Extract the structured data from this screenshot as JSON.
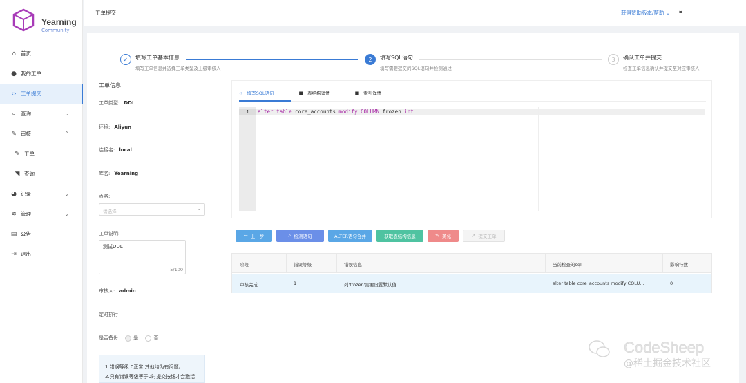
{
  "brand": {
    "name": "Yearning",
    "edition": "Community"
  },
  "menu": [
    {
      "label": "首页",
      "icon": "home-icon",
      "glyph": "⌂",
      "chevron": ""
    },
    {
      "label": "我的工单",
      "icon": "user-icon",
      "glyph": "●",
      "chevron": ""
    },
    {
      "label": "工单提交",
      "icon": "code-icon",
      "glyph": "‹›",
      "chevron": ""
    },
    {
      "label": "查询",
      "icon": "search-icon",
      "glyph": "⌕",
      "chevron": "⌄"
    },
    {
      "label": "审核",
      "icon": "edit-icon",
      "glyph": "✎",
      "chevron": "⌃"
    },
    {
      "label": "工单",
      "icon": "pen-icon",
      "glyph": "✎",
      "chevron": ""
    },
    {
      "label": "查询",
      "icon": "rss-icon",
      "glyph": "◥",
      "chevron": ""
    },
    {
      "label": "记录",
      "icon": "pie-chart-icon",
      "glyph": "◕",
      "chevron": "⌄"
    },
    {
      "label": "管理",
      "icon": "layers-icon",
      "glyph": "≋",
      "chevron": "⌄"
    },
    {
      "label": "公告",
      "icon": "clipboard-icon",
      "glyph": "▤",
      "chevron": ""
    },
    {
      "label": "退出",
      "icon": "logout-icon",
      "glyph": "⇥",
      "chevron": ""
    }
  ],
  "topbar": {
    "title": "工单提交",
    "help": "获得赞助版本/帮助 ⌄"
  },
  "steps": [
    {
      "title": "填写工单基本信息",
      "desc": "填写工单信息并选择工单类型及上级审核人",
      "marker": "✓",
      "state": "done"
    },
    {
      "title": "填写SQL语句",
      "desc": "填写需要提交的SQL语句并检测通过",
      "marker": "2",
      "state": "current"
    },
    {
      "title": "确认工单并提交",
      "desc": "检查工单信息确认并提交至对应审核人",
      "marker": "3",
      "state": "wait"
    }
  ],
  "form": {
    "section_title": "工单信息",
    "type_label": "工单类型:",
    "type_value": "DDL",
    "env_label": "环境:",
    "env_value": "Aliyun",
    "conn_label": "连接名:",
    "conn_value": "local",
    "db_label": "库名:",
    "db_value": "Yearning",
    "table_label": "表名:",
    "table_placeholder": "请选择",
    "desc_label": "工单说明:",
    "desc_value": "测试DDL",
    "desc_count": "5/100",
    "reviewer_label": "审核人:",
    "reviewer_value": "admin",
    "schedule_label": "定时执行",
    "backup_label": "是否备份",
    "backup_yes": "是",
    "backup_no": "否"
  },
  "tips": [
    "1.错误等级 0正常,其他均为有问题。",
    "2.只有错误等级等于0时提交按钮才会激活"
  ],
  "editor": {
    "tabs": [
      {
        "label": "填写SQL语句",
        "icon": "code-icon",
        "glyph": "‹›"
      },
      {
        "label": "表结构详情",
        "icon": "folder-icon",
        "glyph": "■"
      },
      {
        "label": "索引详情",
        "icon": "folder-icon",
        "glyph": "■"
      }
    ],
    "line_number": "1"
  },
  "sql_tokens": [
    {
      "t": "alter",
      "kw": true
    },
    {
      "t": " ",
      "kw": false
    },
    {
      "t": "table",
      "kw": true
    },
    {
      "t": " core_accounts ",
      "kw": false
    },
    {
      "t": "modify",
      "kw": true
    },
    {
      "t": " ",
      "kw": false
    },
    {
      "t": "COLUMN",
      "kw": true
    },
    {
      "t": " frozen ",
      "kw": false
    },
    {
      "t": "int",
      "kw": true
    }
  ],
  "buttons": [
    {
      "label": "上一步",
      "icon": "arrow-left-icon",
      "glyph": "←",
      "color": "#5aa7e6",
      "name": "prev-step-button"
    },
    {
      "label": "检测语句",
      "icon": "search-icon",
      "glyph": "⌕",
      "color": "#6b8fe8",
      "name": "check-sql-button"
    },
    {
      "label": "ALTER语句合并",
      "icon": "",
      "glyph": "",
      "color": "#5aa7e6",
      "name": "merge-alter-button"
    },
    {
      "label": "获取表结构信息",
      "icon": "",
      "glyph": "",
      "color": "#4fc3a1",
      "name": "fetch-schema-button"
    },
    {
      "label": "美化",
      "icon": "brush-icon",
      "glyph": "✎",
      "color": "#ef8a8a",
      "name": "beautify-button"
    },
    {
      "label": "提交工单",
      "icon": "send-icon",
      "glyph": "➚",
      "color": "#f4f4f4",
      "name": "submit-order-button"
    }
  ],
  "result_table": {
    "headers": [
      "阶段",
      "错误等级",
      "错误信息",
      "当前检查的sql",
      "影响行数"
    ],
    "rows": [
      [
        "审核完成",
        "1",
        "列'frozen'需要设置默认值",
        "alter table core_accounts modify COLU...",
        "0"
      ]
    ]
  },
  "watermark": {
    "line1": "CodeSheep",
    "line2": "@稀土掘金技术社区"
  },
  "colors": {
    "accent": "#3a7bd5",
    "brand": "#9b3bb0"
  }
}
